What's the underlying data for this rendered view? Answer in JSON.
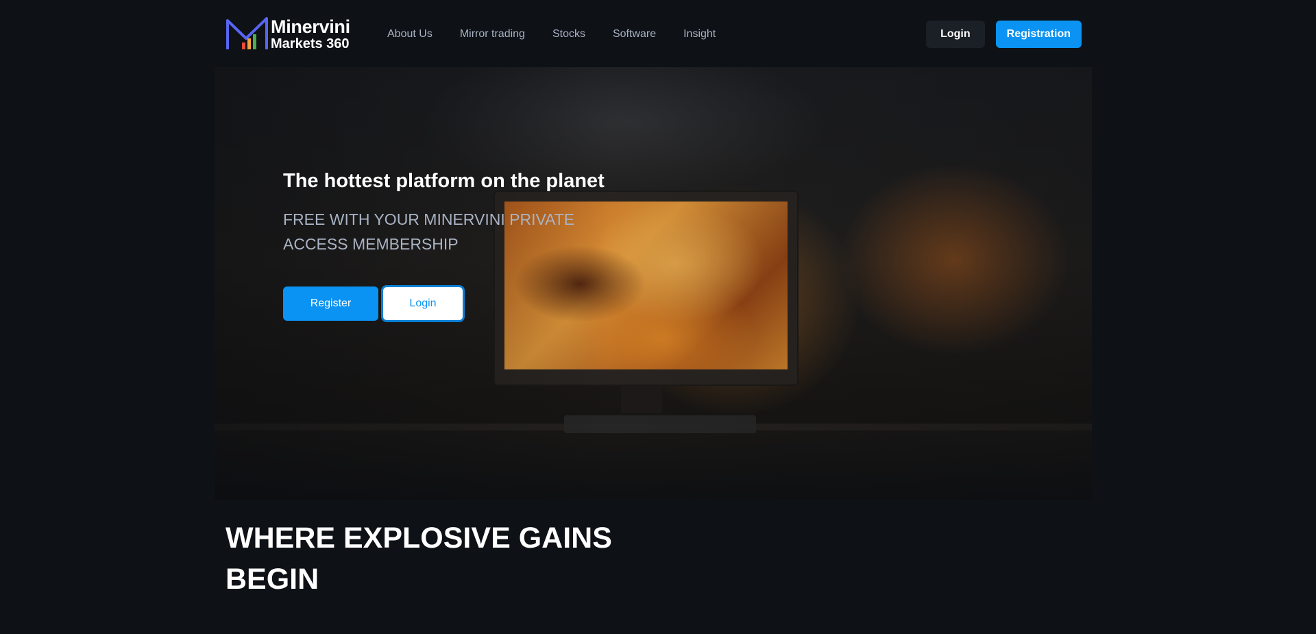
{
  "brand": {
    "name_line1": "Minervini",
    "name_line2": "Markets 360",
    "accent_color": "#0a93f2",
    "logo_stroke_color": "#5865f2"
  },
  "nav": {
    "items": [
      {
        "label": "About Us"
      },
      {
        "label": "Mirror trading"
      },
      {
        "label": "Stocks"
      },
      {
        "label": "Software"
      },
      {
        "label": "Insight"
      }
    ]
  },
  "header_actions": {
    "login_label": "Login",
    "registration_label": "Registration"
  },
  "hero": {
    "title": "The hottest platform on the planet",
    "subtitle": "FREE WITH YOUR MINERVINI PRIVATE ACCESS MEMBERSHIP",
    "register_label": "Register",
    "login_label": "Login"
  },
  "section": {
    "heading": "WHERE EXPLOSIVE GAINS BEGIN"
  }
}
